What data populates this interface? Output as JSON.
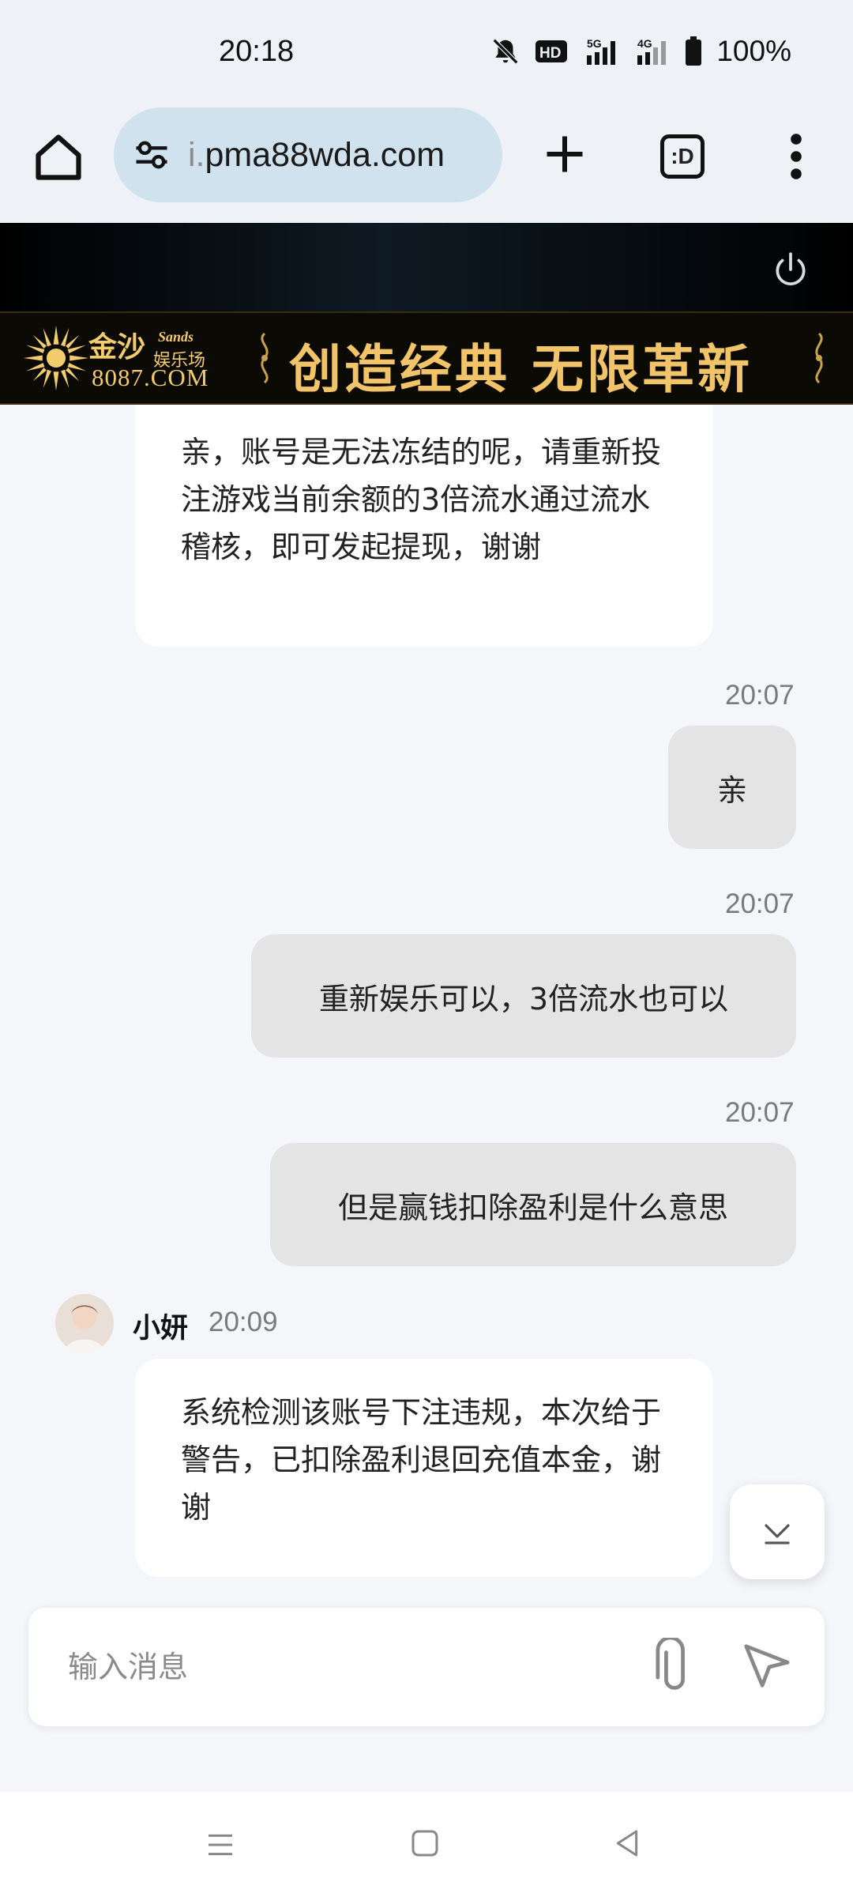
{
  "status_bar": {
    "time": "20:18",
    "icons": [
      "mute-icon",
      "hd-icon",
      "signal-5g-icon",
      "signal-4g-icon",
      "battery-icon"
    ],
    "hd_label": "HD",
    "net1": "5G",
    "net2": "4G",
    "battery": "100%"
  },
  "browser": {
    "url_prefix": "i.",
    "url_domain": "pma88wda.com",
    "tab_switch_label": ":D"
  },
  "banner": {
    "logo_cn": "金沙",
    "logo_en": "Sands",
    "logo_sub": "娱乐场",
    "logo_url": "8087.COM",
    "slogan": "创造经典 无限革新",
    "gold": "#f1c46a"
  },
  "messages": {
    "m1_text": "亲，账号是无法冻结的呢，请重新投注游戏当前余额的3倍流水通过流水稽核，即可发起提现，谢谢",
    "m2_time": "20:07",
    "m2_text": "亲",
    "m3_time": "20:07",
    "m3_text": "重新娱乐可以，3倍流水也可以",
    "m4_time": "20:07",
    "m4_text": "但是赢钱扣除盈利是什么意思",
    "m5_sender": "小妍",
    "m5_time": "20:09",
    "m5_text": "系统检测该账号下注违规，本次给于警告，已扣除盈利退回充值本金，谢谢"
  },
  "input": {
    "placeholder": "输入消息"
  },
  "colors": {
    "bubble_out": "#e4e4e4",
    "bubble_in": "#ffffff",
    "chat_bg": "#f4f6fa"
  }
}
